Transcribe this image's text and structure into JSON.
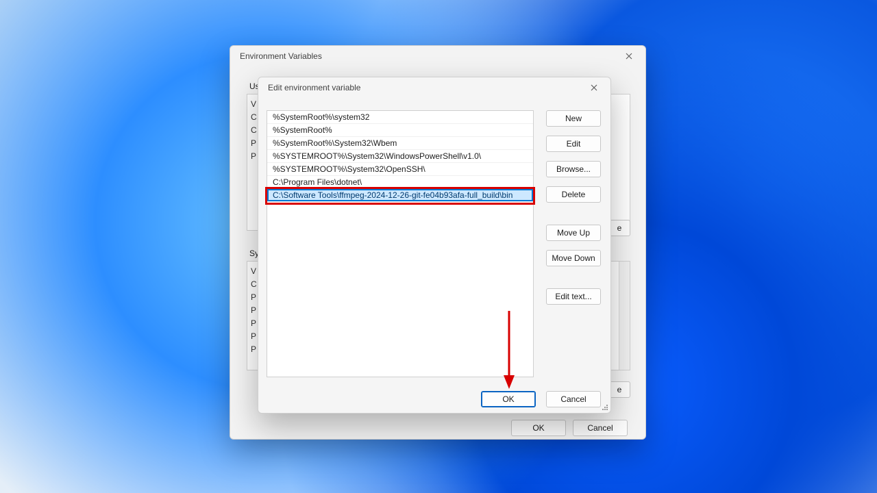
{
  "env_dialog": {
    "title": "Environment Variables",
    "user_section_label": "Use",
    "sys_section_label": "Sys",
    "left_fragments": [
      "V",
      "C",
      "C",
      "P",
      "P"
    ],
    "sys_left_fragments": [
      "V",
      "C",
      "P",
      "P",
      "P",
      "P",
      "P"
    ],
    "ok_label": "OK",
    "cancel_label": "Cancel"
  },
  "edit_dialog": {
    "title": "Edit environment variable",
    "paths": [
      "%SystemRoot%\\system32",
      "%SystemRoot%",
      "%SystemRoot%\\System32\\Wbem",
      "%SYSTEMROOT%\\System32\\WindowsPowerShell\\v1.0\\",
      "%SYSTEMROOT%\\System32\\OpenSSH\\",
      "C:\\Program Files\\dotnet\\"
    ],
    "selected_path": "C:\\Software Tools\\ffmpeg-2024-12-26-git-fe04b93afa-full_build\\bin",
    "buttons": {
      "new": "New",
      "edit": "Edit",
      "browse": "Browse...",
      "delete": "Delete",
      "move_up": "Move Up",
      "move_down": "Move Down",
      "edit_text": "Edit text..."
    },
    "ok_label": "OK",
    "cancel_label": "Cancel"
  }
}
